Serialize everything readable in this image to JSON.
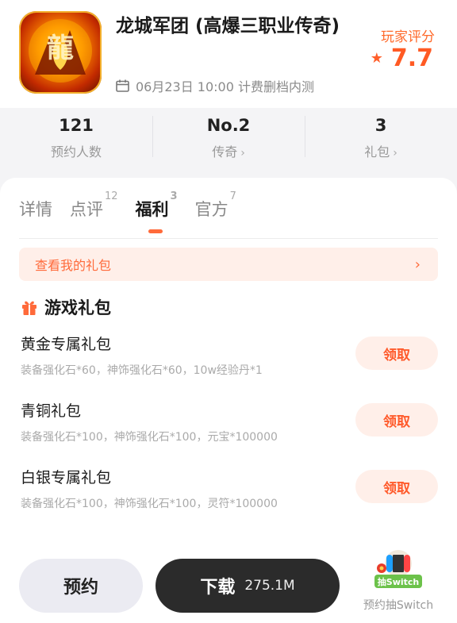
{
  "app": {
    "title": "龙城军团 (高爆三职业传奇)",
    "test_info": "06月23日 10:00 计费删档内测",
    "rating_label": "玩家评分",
    "rating_value": "7.7",
    "icon": "game-logo-dragon-warrior"
  },
  "stats": [
    {
      "value": "121",
      "label": "预约人数"
    },
    {
      "value": "No.2",
      "label": "传奇"
    },
    {
      "value": "3",
      "label": "礼包"
    }
  ],
  "tabs": [
    {
      "label": "详情",
      "count": ""
    },
    {
      "label": "点评",
      "count": "12"
    },
    {
      "label": "福利",
      "count": "3"
    },
    {
      "label": "官方",
      "count": "7"
    }
  ],
  "my_gifts_label": "查看我的礼包",
  "section_title": "游戏礼包",
  "packages": [
    {
      "name": "黄金专属礼包",
      "desc": "装备强化石*60，神饰强化石*60，10w经验丹*1",
      "action": "领取"
    },
    {
      "name": "青铜礼包",
      "desc": "装备强化石*100，神饰强化石*100，元宝*100000",
      "action": "领取"
    },
    {
      "name": "白银专属礼包",
      "desc": "装备强化石*100，神饰强化石*100，灵符*100000",
      "action": "领取"
    }
  ],
  "bottom": {
    "reserve_label": "预约",
    "download_label": "下载",
    "download_size": "275.1M",
    "switch_badge": "抽Switch",
    "switch_label": "预约抽Switch"
  },
  "colors": {
    "accent": "#ff6a3a",
    "rating": "#ff5a24",
    "download_bg": "#2b2b2b"
  }
}
